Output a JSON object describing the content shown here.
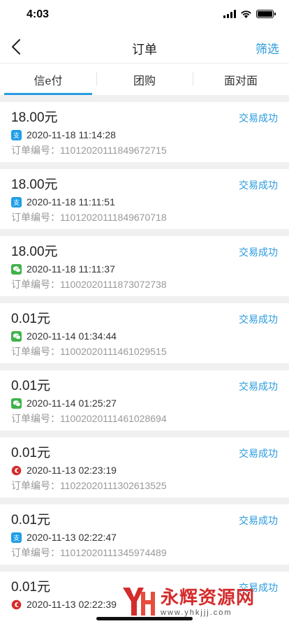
{
  "status_bar": {
    "time": "4:03"
  },
  "nav": {
    "title": "订单",
    "filter_label": "筛选"
  },
  "tabs": [
    {
      "label": "信e付",
      "active": true
    },
    {
      "label": "团购",
      "active": false
    },
    {
      "label": "面对面",
      "active": false
    }
  ],
  "order_no_prefix": "订单编号：",
  "orders": [
    {
      "amount": "18.00元",
      "status": "交易成功",
      "pay_method": "alipay",
      "datetime": "2020-11-18 11:14:28",
      "order_no": "11012020111849672715"
    },
    {
      "amount": "18.00元",
      "status": "交易成功",
      "pay_method": "alipay",
      "datetime": "2020-11-18 11:11:51",
      "order_no": "11012020111849670718"
    },
    {
      "amount": "18.00元",
      "status": "交易成功",
      "pay_method": "wechat",
      "datetime": "2020-11-18 11:11:37",
      "order_no": "11002020111873072738"
    },
    {
      "amount": "0.01元",
      "status": "交易成功",
      "pay_method": "wechat",
      "datetime": "2020-11-14 01:34:44",
      "order_no": "11002020111461029515"
    },
    {
      "amount": "0.01元",
      "status": "交易成功",
      "pay_method": "wechat",
      "datetime": "2020-11-14 01:25:27",
      "order_no": "11002020111461028694"
    },
    {
      "amount": "0.01元",
      "status": "交易成功",
      "pay_method": "unionpay",
      "datetime": "2020-11-13 02:23:19",
      "order_no": "11022020111302613525"
    },
    {
      "amount": "0.01元",
      "status": "交易成功",
      "pay_method": "alipay",
      "datetime": "2020-11-13 02:22:47",
      "order_no": "11012020111345974489"
    },
    {
      "amount": "0.01元",
      "status": "交易成功",
      "pay_method": "unionpay",
      "datetime": "2020-11-13 02:22:39",
      "order_no": ""
    }
  ],
  "watermark": {
    "name": "永辉资源网",
    "url": "www.yhkjjj.com"
  },
  "colors": {
    "accent": "#2a9be0",
    "alipay": "#1f9fe8",
    "wechat": "#3fb24a",
    "unionpay": "#d42c2c"
  }
}
